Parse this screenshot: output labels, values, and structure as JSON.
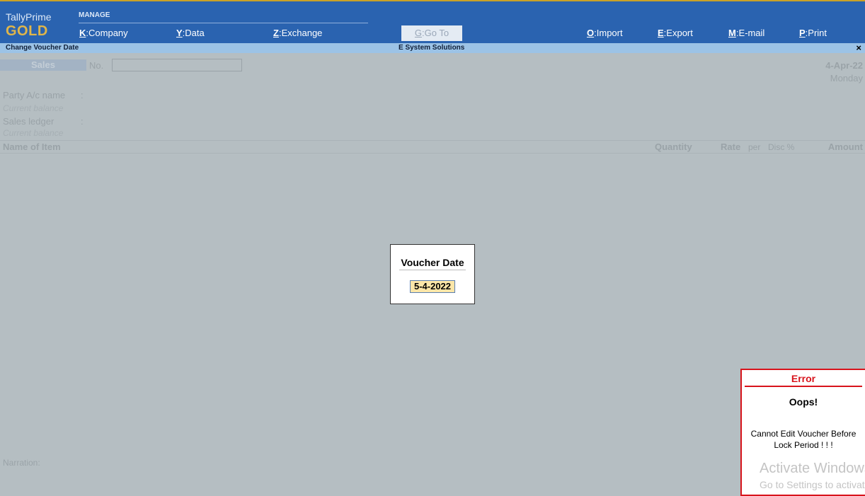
{
  "brand": {
    "name": "TallyPrime",
    "edition": "GOLD"
  },
  "menu": {
    "group_label": "MANAGE",
    "items": [
      {
        "key": "K",
        "label": "Company"
      },
      {
        "key": "Y",
        "label": "Data"
      },
      {
        "key": "Z",
        "label": "Exchange"
      },
      {
        "key": "G",
        "label": "Go To"
      },
      {
        "key": "O",
        "label": "Import"
      },
      {
        "key": "E",
        "label": "Export"
      },
      {
        "key": "M",
        "label": "E-mail"
      },
      {
        "key": "P",
        "label": "Print"
      }
    ]
  },
  "titlebar": {
    "left": "Change Voucher Date",
    "center": "E System Solutions",
    "close": "×"
  },
  "voucher": {
    "type": "Sales",
    "no_label": "No.",
    "date": "4-Apr-22",
    "day": "Monday",
    "party_label": "Party A/c name",
    "current_balance_label": "Current balance",
    "sales_ledger_label": "Sales ledger",
    "colon": ":",
    "columns": {
      "name_of_item": "Name of Item",
      "quantity": "Quantity",
      "rate": "Rate",
      "per": "per",
      "disc": "Disc %",
      "amount": "Amount"
    },
    "narration_label": "Narration:"
  },
  "dialog": {
    "title": "Voucher Date",
    "value": "5-4-2022"
  },
  "error": {
    "title": "Error",
    "heading": "Oops!",
    "message_line1": "Cannot Edit Voucher Before",
    "message_line2": "Lock Period ! ! !"
  },
  "watermark": {
    "line1": "Activate Windows",
    "line2": "Go to Settings to activate Windows."
  }
}
